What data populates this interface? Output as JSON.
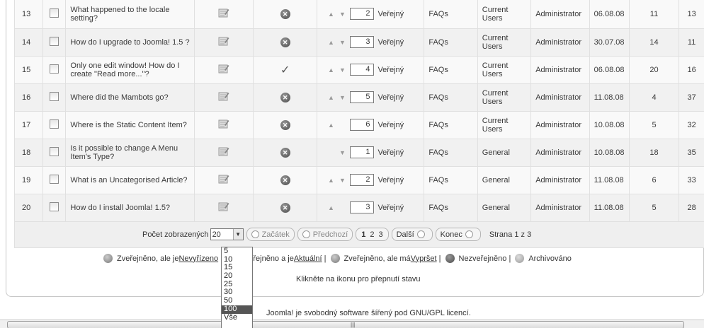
{
  "rows": [
    {
      "num": "13",
      "title": "What happened to the locale setting?",
      "state": "unpublished",
      "order": "2",
      "up": true,
      "down": true,
      "access": "Veřejný",
      "section": "FAQs",
      "category": "Current Users",
      "author": "Administrator",
      "date": "06.08.08",
      "hits": "11",
      "id": "13"
    },
    {
      "num": "14",
      "title": "How do I upgrade to Joomla! 1.5 ?",
      "state": "unpublished",
      "order": "3",
      "up": true,
      "down": true,
      "access": "Veřejný",
      "section": "FAQs",
      "category": "Current Users",
      "author": "Administrator",
      "date": "30.07.08",
      "hits": "14",
      "id": "11"
    },
    {
      "num": "15",
      "title": "Only one edit window! How do I create \"Read more...\"?",
      "state": "published",
      "order": "4",
      "up": true,
      "down": true,
      "access": "Veřejný",
      "section": "FAQs",
      "category": "Current Users",
      "author": "Administrator",
      "date": "06.08.08",
      "hits": "20",
      "id": "16"
    },
    {
      "num": "16",
      "title": "Where did the Mambots go?",
      "state": "unpublished",
      "order": "5",
      "up": true,
      "down": true,
      "access": "Veřejný",
      "section": "FAQs",
      "category": "Current Users",
      "author": "Administrator",
      "date": "11.08.08",
      "hits": "4",
      "id": "37"
    },
    {
      "num": "17",
      "title": "Where is the Static Content Item?",
      "state": "unpublished",
      "order": "6",
      "up": true,
      "down": false,
      "access": "Veřejný",
      "section": "FAQs",
      "category": "Current Users",
      "author": "Administrator",
      "date": "10.08.08",
      "hits": "5",
      "id": "32"
    },
    {
      "num": "18",
      "title": "Is it possible to change A Menu Item's Type?",
      "state": "unpublished",
      "order": "1",
      "up": false,
      "down": true,
      "access": "Veřejný",
      "section": "FAQs",
      "category": "General",
      "author": "Administrator",
      "date": "10.08.08",
      "hits": "18",
      "id": "35"
    },
    {
      "num": "19",
      "title": "What is an Uncategorised Article?",
      "state": "unpublished",
      "order": "2",
      "up": true,
      "down": true,
      "access": "Veřejný",
      "section": "FAQs",
      "category": "General",
      "author": "Administrator",
      "date": "11.08.08",
      "hits": "6",
      "id": "33"
    },
    {
      "num": "20",
      "title": "How do I install Joomla! 1.5?",
      "state": "unpublished",
      "order": "3",
      "up": true,
      "down": false,
      "access": "Veřejný",
      "section": "FAQs",
      "category": "General",
      "author": "Administrator",
      "date": "11.08.08",
      "hits": "5",
      "id": "28"
    }
  ],
  "pager": {
    "limit_label": "Počet zobrazených",
    "limit_value": "20",
    "start": "Začátek",
    "prev": "Předchozí",
    "pages": [
      "1",
      "2",
      "3"
    ],
    "next": "Další",
    "end": "Konec",
    "page_info": "Strana 1 z 3"
  },
  "limit_options": [
    "5",
    "10",
    "15",
    "20",
    "25",
    "30",
    "50",
    "100",
    "Vše"
  ],
  "limit_options_selected": "100",
  "legend": {
    "pending_pre": "Zveřejněno, ale je ",
    "pending_link": "Nevyřízeno",
    "current_pre": "Zveřejněno a je ",
    "current_link": "Aktuální",
    "expired_pre": "Zveřejněno, ale má ",
    "expired_link": "Vypršet",
    "unpublished": "Nezveřejněno",
    "archived": "Archivováno",
    "sep": "|"
  },
  "hint": "Klikněte na ikonu pro přepnutí stavu",
  "footer": {
    "pre": "Joomla! je svobodný software šířený pod ",
    "link": "GNU/GPL licencí",
    "post": "."
  },
  "colors": {
    "row_even": "#f9f9f9",
    "row_odd": "#f1f1f1",
    "selected_option": "#555555"
  }
}
